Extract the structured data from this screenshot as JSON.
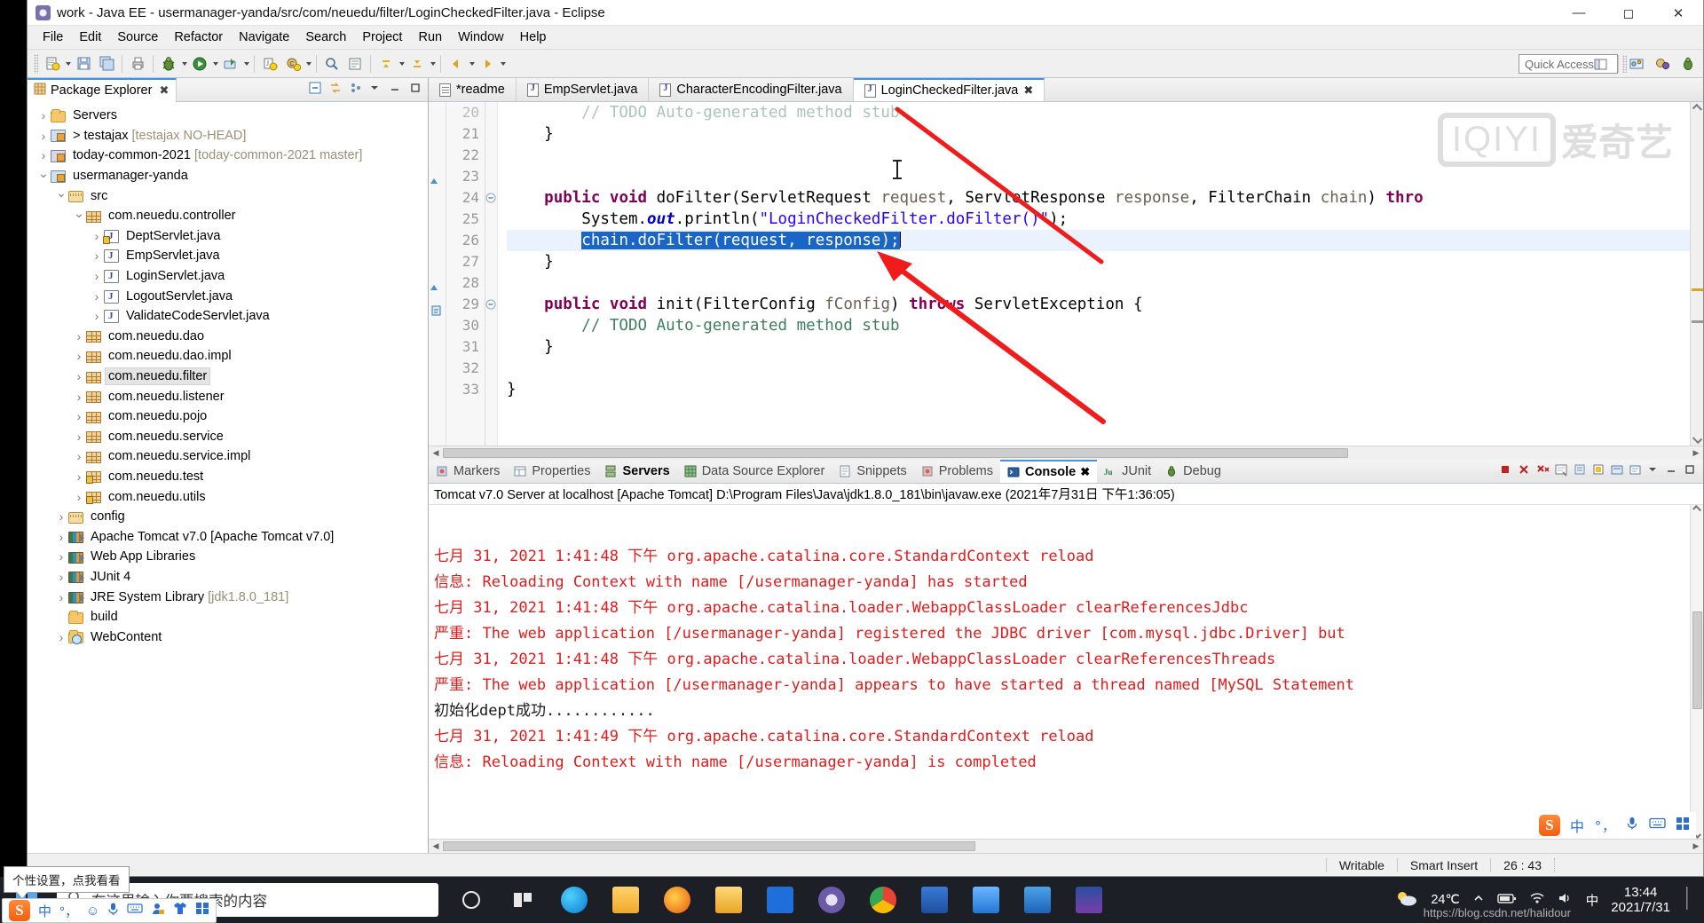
{
  "window": {
    "title": "work - Java EE - usermanager-yanda/src/com/neuedu/filter/LoginCheckedFilter.java - Eclipse",
    "minimize_label": "─",
    "maximize_label": "☐",
    "close_label": "✕"
  },
  "menu": [
    "File",
    "Edit",
    "Source",
    "Refactor",
    "Navigate",
    "Search",
    "Project",
    "Run",
    "Window",
    "Help"
  ],
  "toolbar": {
    "quick_access_placeholder": "Quick Access"
  },
  "package_explorer": {
    "tab_label": "Package Explorer",
    "close_label": "✖",
    "items": [
      {
        "label": "Servers",
        "suffix": "",
        "indent": 0,
        "twisty": "closed",
        "icon": "folder-icon",
        "selected": false
      },
      {
        "label": "> testajax",
        "suffix": " [testajax NO-HEAD]",
        "indent": 0,
        "twisty": "closed",
        "icon": "project-icon",
        "selected": false
      },
      {
        "label": "today-common-2021",
        "suffix": " [today-common-2021 master]",
        "indent": 0,
        "twisty": "closed",
        "icon": "project-gray-icon",
        "selected": false
      },
      {
        "label": "usermanager-yanda",
        "suffix": "",
        "indent": 0,
        "twisty": "open",
        "icon": "project-icon",
        "selected": false
      },
      {
        "label": "src",
        "suffix": "",
        "indent": 1,
        "twisty": "open",
        "icon": "source-folder-icon",
        "selected": false
      },
      {
        "label": "com.neuedu.controller",
        "suffix": "",
        "indent": 2,
        "twisty": "open",
        "icon": "package-icon",
        "selected": false
      },
      {
        "label": "DeptServlet.java",
        "suffix": "",
        "indent": 3,
        "twisty": "closed",
        "icon": "java-file-lock-icon",
        "selected": false
      },
      {
        "label": "EmpServlet.java",
        "suffix": "",
        "indent": 3,
        "twisty": "closed",
        "icon": "java-file-icon",
        "selected": false
      },
      {
        "label": "LoginServlet.java",
        "suffix": "",
        "indent": 3,
        "twisty": "closed",
        "icon": "java-file-icon",
        "selected": false
      },
      {
        "label": "LogoutServlet.java",
        "suffix": "",
        "indent": 3,
        "twisty": "closed",
        "icon": "java-file-icon",
        "selected": false
      },
      {
        "label": "ValidateCodeServlet.java",
        "suffix": "",
        "indent": 3,
        "twisty": "closed",
        "icon": "java-file-icon",
        "selected": false
      },
      {
        "label": "com.neuedu.dao",
        "suffix": "",
        "indent": 2,
        "twisty": "closed",
        "icon": "package-icon",
        "selected": false
      },
      {
        "label": "com.neuedu.dao.impl",
        "suffix": "",
        "indent": 2,
        "twisty": "closed",
        "icon": "package-icon",
        "selected": false
      },
      {
        "label": "com.neuedu.filter",
        "suffix": "",
        "indent": 2,
        "twisty": "closed",
        "icon": "package-icon",
        "selected": true
      },
      {
        "label": "com.neuedu.listener",
        "suffix": "",
        "indent": 2,
        "twisty": "closed",
        "icon": "package-icon",
        "selected": false
      },
      {
        "label": "com.neuedu.pojo",
        "suffix": "",
        "indent": 2,
        "twisty": "closed",
        "icon": "package-icon",
        "selected": false
      },
      {
        "label": "com.neuedu.service",
        "suffix": "",
        "indent": 2,
        "twisty": "closed",
        "icon": "package-icon",
        "selected": false
      },
      {
        "label": "com.neuedu.service.impl",
        "suffix": "",
        "indent": 2,
        "twisty": "closed",
        "icon": "package-icon",
        "selected": false
      },
      {
        "label": "com.neuedu.test",
        "suffix": "",
        "indent": 2,
        "twisty": "closed",
        "icon": "package-lock-icon",
        "selected": false
      },
      {
        "label": "com.neuedu.utils",
        "suffix": "",
        "indent": 2,
        "twisty": "closed",
        "icon": "package-lock-icon",
        "selected": false
      },
      {
        "label": "config",
        "suffix": "",
        "indent": 1,
        "twisty": "closed",
        "icon": "source-folder-icon",
        "selected": false
      },
      {
        "label": "Apache Tomcat v7.0 [Apache Tomcat v7.0]",
        "suffix": "",
        "indent": 1,
        "twisty": "closed",
        "icon": "library-icon",
        "selected": false
      },
      {
        "label": "Web App Libraries",
        "suffix": "",
        "indent": 1,
        "twisty": "closed",
        "icon": "library-icon",
        "selected": false
      },
      {
        "label": "JUnit 4",
        "suffix": "",
        "indent": 1,
        "twisty": "closed",
        "icon": "library-icon",
        "selected": false
      },
      {
        "label": "JRE System Library",
        "suffix": " [jdk1.8.0_181]",
        "indent": 1,
        "twisty": "closed",
        "icon": "library-icon",
        "selected": false
      },
      {
        "label": "build",
        "suffix": "",
        "indent": 1,
        "twisty": "none",
        "icon": "folder-icon",
        "selected": false
      },
      {
        "label": "WebContent",
        "suffix": "",
        "indent": 1,
        "twisty": "closed",
        "icon": "web-folder-icon",
        "selected": false
      }
    ]
  },
  "editor": {
    "tabs": [
      {
        "label": "*readme",
        "icon": "text-file-icon",
        "active": false,
        "closable": false
      },
      {
        "label": "EmpServlet.java",
        "icon": "java-file-icon",
        "active": false,
        "closable": false
      },
      {
        "label": "CharacterEncodingFilter.java",
        "icon": "java-file-icon",
        "active": false,
        "closable": false
      },
      {
        "label": "LoginCheckedFilter.java",
        "icon": "java-file-icon",
        "active": true,
        "closable": true
      }
    ],
    "close_label": "✖",
    "watermark": {
      "box_text": "IQIYI",
      "text": "爱奇艺"
    },
    "lines": [
      {
        "num": "20",
        "partial": true,
        "segments": [
          {
            "t": "        // TODO Auto-generated method stub",
            "c": "cmt"
          }
        ]
      },
      {
        "num": "21",
        "segments": [
          {
            "t": "    }",
            "c": ""
          }
        ]
      },
      {
        "num": "22",
        "segments": [
          {
            "t": "",
            "c": ""
          }
        ]
      },
      {
        "num": "23",
        "segments": [
          {
            "t": "",
            "c": ""
          }
        ]
      },
      {
        "num": "24",
        "fold": true,
        "segments": [
          {
            "t": "    ",
            "c": ""
          },
          {
            "t": "public",
            "c": "kw"
          },
          {
            "t": " ",
            "c": ""
          },
          {
            "t": "void",
            "c": "kw"
          },
          {
            "t": " doFilter(ServletRequest ",
            "c": ""
          },
          {
            "t": "request",
            "c": "prm"
          },
          {
            "t": ", ServletResponse ",
            "c": ""
          },
          {
            "t": "response",
            "c": "prm"
          },
          {
            "t": ", FilterChain ",
            "c": ""
          },
          {
            "t": "chain",
            "c": "prm"
          },
          {
            "t": ") ",
            "c": ""
          },
          {
            "t": "thro",
            "c": "kw"
          }
        ]
      },
      {
        "num": "25",
        "segments": [
          {
            "t": "        System.",
            "c": ""
          },
          {
            "t": "out",
            "c": "fld"
          },
          {
            "t": ".println(",
            "c": ""
          },
          {
            "t": "\"LoginCheckedFilter.doFilter()\"",
            "c": "str"
          },
          {
            "t": ");",
            "c": ""
          }
        ]
      },
      {
        "num": "26",
        "highlight": true,
        "selection": "chain.doFilter(request, response);",
        "indent": "        "
      },
      {
        "num": "27",
        "segments": [
          {
            "t": "    }",
            "c": ""
          }
        ]
      },
      {
        "num": "28",
        "segments": [
          {
            "t": "",
            "c": ""
          }
        ]
      },
      {
        "num": "29",
        "fold": true,
        "segments": [
          {
            "t": "    ",
            "c": ""
          },
          {
            "t": "public",
            "c": "kw"
          },
          {
            "t": " ",
            "c": ""
          },
          {
            "t": "void",
            "c": "kw"
          },
          {
            "t": " init(FilterConfig ",
            "c": ""
          },
          {
            "t": "fConfig",
            "c": "prm"
          },
          {
            "t": ") ",
            "c": ""
          },
          {
            "t": "throws",
            "c": "kw"
          },
          {
            "t": " ServletException {",
            "c": ""
          }
        ]
      },
      {
        "num": "30",
        "warn": true,
        "segments": [
          {
            "t": "        // TODO Auto-generated method stub",
            "c": "cmt"
          }
        ]
      },
      {
        "num": "31",
        "segments": [
          {
            "t": "    }",
            "c": ""
          }
        ]
      },
      {
        "num": "32",
        "segments": [
          {
            "t": "",
            "c": ""
          }
        ]
      },
      {
        "num": "33",
        "segments": [
          {
            "t": "}",
            "c": ""
          }
        ]
      }
    ]
  },
  "console": {
    "tabs": [
      {
        "label": "Markers",
        "icon": "markers-icon",
        "active": false,
        "bold": false
      },
      {
        "label": "Properties",
        "icon": "properties-icon",
        "active": false,
        "bold": false
      },
      {
        "label": "Servers",
        "icon": "servers-icon",
        "active": false,
        "bold": true
      },
      {
        "label": "Data Source Explorer",
        "icon": "data-source-icon",
        "active": false,
        "bold": false
      },
      {
        "label": "Snippets",
        "icon": "snippets-icon",
        "active": false,
        "bold": false
      },
      {
        "label": "Problems",
        "icon": "problems-icon",
        "active": false,
        "bold": false
      },
      {
        "label": "Console",
        "icon": "console-icon",
        "active": true,
        "bold": true
      },
      {
        "label": "JUnit",
        "icon": "junit-icon",
        "active": false,
        "bold": false
      },
      {
        "label": "Debug",
        "icon": "debug-icon",
        "active": false,
        "bold": false
      }
    ],
    "close_label": "✖",
    "header": "Tomcat v7.0 Server at localhost [Apache Tomcat] D:\\Program Files\\Java\\jdk1.8.0_181\\bin\\javaw.exe (2021年7月31日 下午1:36:05)",
    "lines": [
      {
        "text": "七月 31, 2021 1:41:48 下午 org.apache.catalina.core.StandardContext reload",
        "color": "red"
      },
      {
        "text": "信息: Reloading Context with name [/usermanager-yanda] has started",
        "color": "red"
      },
      {
        "text": "七月 31, 2021 1:41:48 下午 org.apache.catalina.loader.WebappClassLoader clearReferencesJdbc",
        "color": "red"
      },
      {
        "text": "严重: The web application [/usermanager-yanda] registered the JDBC driver [com.mysql.jdbc.Driver] but",
        "color": "red"
      },
      {
        "text": "七月 31, 2021 1:41:48 下午 org.apache.catalina.loader.WebappClassLoader clearReferencesThreads",
        "color": "red"
      },
      {
        "text": "严重: The web application [/usermanager-yanda] appears to have started a thread named [MySQL Statement",
        "color": "red"
      },
      {
        "text": "初始化dept成功............",
        "color": "dark"
      },
      {
        "text": "七月 31, 2021 1:41:49 下午 org.apache.catalina.core.StandardContext reload",
        "color": "red"
      },
      {
        "text": "信息: Reloading Context with name [/usermanager-yanda] is completed",
        "color": "red"
      }
    ]
  },
  "statusbar": {
    "writable": "Writable",
    "insert_mode": "Smart Insert",
    "cursor_position": "26 : 43"
  },
  "taskbar": {
    "search_placeholder": "在这里输入你要搜索的内容",
    "temperature": "24℃",
    "time": "13:44",
    "date": "2021/7/31",
    "watermark": "https://blog.csdn.net/halidour"
  },
  "ime": {
    "tooltip": "个性设置，点我看看",
    "language": "中",
    "punctuation": "°，",
    "logo": "S"
  },
  "colors": {
    "accent": "#4a90d9",
    "selection": "#1966c8",
    "line_highlight": "#eaf2fd",
    "console_error": "#e01b1b",
    "keyword": "#7f0055",
    "string": "#2a00ff",
    "comment": "#3f7f5f",
    "arrow": "#f01c1c"
  }
}
